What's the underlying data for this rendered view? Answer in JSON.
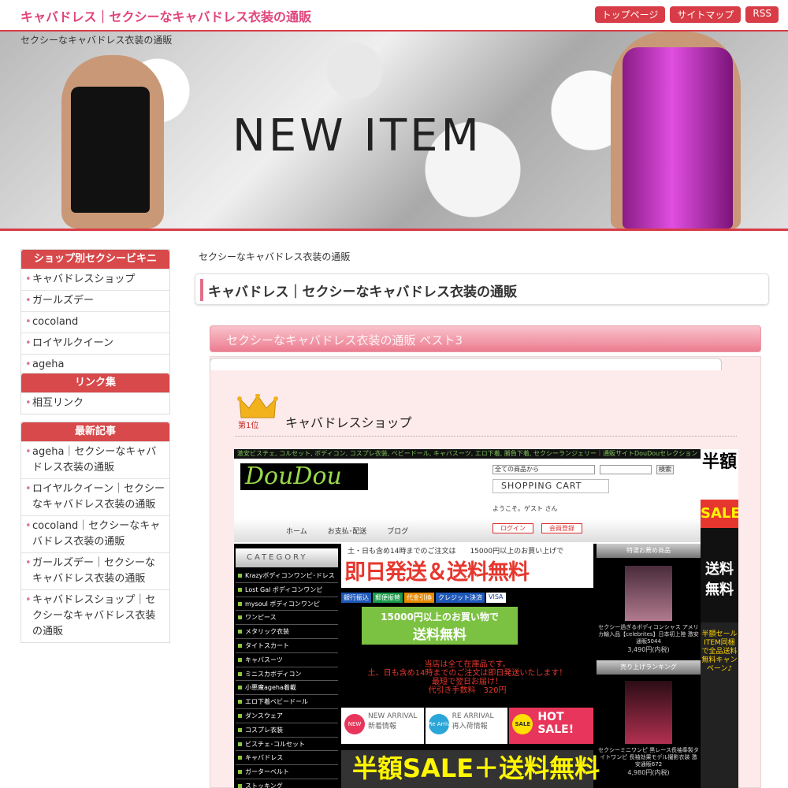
{
  "header": {
    "title": "キャバドレス｜セクシーなキャバドレス衣装の通販",
    "nav": [
      "トップページ",
      "サイトマップ",
      "RSS"
    ]
  },
  "banner": {
    "subtitle": "セクシーなキャバドレス衣装の通販",
    "heading": "NEW ITEM"
  },
  "sidebar": {
    "shops": {
      "title": "ショップ別セクシービキニ",
      "items": [
        "キャバドレスショップ",
        "ガールズデー",
        "cocoland",
        "ロイヤルクイーン",
        "ageha"
      ]
    },
    "links": {
      "title": "リンク集",
      "items": [
        "相互リンク"
      ]
    },
    "recent": {
      "title": "最新記事",
      "items": [
        "ageha｜セクシーなキャバドレス衣装の通販",
        "ロイヤルクイーン｜セクシーなキャバドレス衣装の通販",
        "cocoland｜セクシーなキャバドレス衣装の通販",
        "ガールズデー｜セクシーなキャバドレス衣装の通販",
        "キャバドレスショップ｜セクシーなキャバドレス衣装の通販"
      ]
    }
  },
  "main": {
    "breadcrumb": "セクシーなキャバドレス衣装の通販",
    "page_title": "キャバドレス｜セクシーなキャバドレス衣装の通販",
    "best_title": "セクシーなキャバドレス衣装の通販 ベスト3",
    "rank1": {
      "badge_text": "第1位",
      "shop_name": "キャバドレスショップ"
    }
  },
  "shop": {
    "topbar": "激安ビスチェ, コルセット, ボディコン, コスプレ衣装, ベビードール, キャバスーツ, エロ下着, 勝負下着, セクシーランジェリー｜通販サイトDouDouセレクション",
    "logo": "DouDou",
    "select": "全ての商品から",
    "search_btn": "検索",
    "cart": "SHOPPING CART",
    "welcome": "ようこそ。ゲスト さん",
    "menu": [
      "ホーム",
      "お支払･配送",
      "ブログ"
    ],
    "login": "ログイン",
    "register": "会員登録",
    "category_head": "CATEGORY",
    "categories": [
      "Krazyボディコンワンピ･ドレス",
      "Lost Gal ボディコンワンピ",
      "mysoul ボディコンワンピ",
      "ワンピース",
      "メタリック衣装",
      "タイトスカート",
      "キャバスーツ",
      "ミニスカボディコン",
      "小悪魔ageha着載",
      "エロ下着ベビードール",
      "ダンスウェア",
      "コスプレ衣装",
      "ビスチェ･コルセット",
      "キャバドレス",
      "ガーターベルト",
      "ストッキング"
    ],
    "promo_top": "土・日も含め14時までのご注文は　　15000円以上のお買い上げで",
    "promo_main": "即日発送＆送料無料",
    "pay": [
      "銀行振込",
      "郵便振替",
      "代金引換",
      "クレジット決済",
      "VISA"
    ],
    "free_ship_top": "15000円以上のお買い物で",
    "free_ship_main": "送料無料",
    "notice": [
      "当店は全て在庫品です。",
      "土、日も含め14時までのご注文は即日発送いたします！",
      "最短で翌日お届け！",
      "代引き手数料　320円"
    ],
    "tiles": [
      {
        "circle": "NEW",
        "line1": "NEW ARRIVAL",
        "line2": "新着情報"
      },
      {
        "circle": "Re Arrival",
        "line1": "RE ARRIVAL",
        "line2": "再入荷情報"
      },
      {
        "circle": "SALE",
        "line1": "HOT",
        "line2": "SALE!"
      }
    ],
    "halfsale": "半額SALE＋送料無料",
    "recommend_head": "特選お薦め商品",
    "recommend_text": "セクシー過ぎるボディコンシャス アメリカ輸入品【celebrites】日本初上陸 激安通販5044",
    "recommend_price": "3,490円(内税)",
    "ranking_head": "売り上げランキング",
    "ranking_text": "セクシーミニワンピ 黒レース長袖奉製タイトワンピ 長袖効果モデル撮影衣装 激安通販672",
    "ranking_price": "4,980円(内税)",
    "side_half": "半額",
    "side_sale": "SALE",
    "side_free": "送料無料",
    "side_campaign": "半額セールITEM同梱で全品送料無料キャンペーン♪"
  },
  "colors": {
    "accent": "#d83c46",
    "title_pink": "#e0457c",
    "panel_bg": "#fdeaea"
  }
}
